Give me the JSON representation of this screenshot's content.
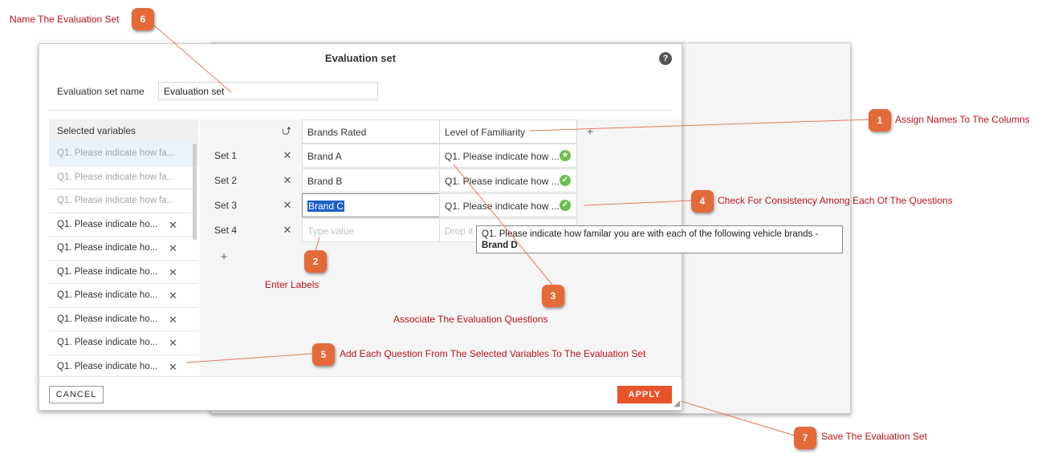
{
  "dialog": {
    "title": "Evaluation set",
    "help_glyph": "?",
    "name_label": "Evaluation set name",
    "name_value": "Evaluation set",
    "cancel_label": "CANCEL",
    "apply_label": "APPLY"
  },
  "variables": {
    "header": "Selected variables",
    "items": [
      {
        "label": "Q1. Please indicate how fa...",
        "used": true
      },
      {
        "label": "Q1. Please indicate how fa...",
        "used": true
      },
      {
        "label": "Q1. Please indicate how fa...",
        "used": true
      },
      {
        "label": "Q1. Please indicate ho...",
        "used": false
      },
      {
        "label": "Q1. Please indicate ho...",
        "used": false
      },
      {
        "label": "Q1. Please indicate ho...",
        "used": false
      },
      {
        "label": "Q1. Please indicate ho...",
        "used": false
      },
      {
        "label": "Q1. Please indicate ho...",
        "used": false
      },
      {
        "label": "Q1. Please indicate ho...",
        "used": false
      },
      {
        "label": "Q1. Please indicate ho...",
        "used": false
      }
    ],
    "remove_glyph": "✕"
  },
  "grid": {
    "columns": [
      "Brands Rated",
      "Level of Familiarity"
    ],
    "rows": [
      {
        "label": "Set 1",
        "brand": "Brand A",
        "question": "Q1. Please indicate how ..."
      },
      {
        "label": "Set 2",
        "brand": "Brand B",
        "question": "Q1. Please indicate how ..."
      },
      {
        "label": "Set 3",
        "brand": "Brand C",
        "question": "Q1. Please indicate how ..."
      },
      {
        "label": "Set 4",
        "brand_placeholder": "Type value",
        "question_placeholder": "Drop it"
      }
    ],
    "remove_glyph": "✕",
    "add_glyph": "+",
    "swap_glyph": "⮍"
  },
  "tooltip": {
    "line1": "Q1. Please indicate how familar you are with each of the following vehicle brands -",
    "line2": "Brand D"
  },
  "annotations": [
    {
      "num": "1",
      "text": "Assign Names To The Columns"
    },
    {
      "num": "2",
      "text": "Enter Labels"
    },
    {
      "num": "3",
      "text": "Associate The Evaluation Questions"
    },
    {
      "num": "4",
      "text": "Check For Consistency Among Each Of The Questions"
    },
    {
      "num": "5",
      "text": "Add Each Question From The Selected Variables To The Evaluation Set"
    },
    {
      "num": "6",
      "text": "Name The Evaluation Set"
    },
    {
      "num": "7",
      "text": "Save The Evaluation Set"
    }
  ],
  "colors": {
    "accent": "#e8532a",
    "badge": "#e46a3a",
    "note_text": "#b8141d",
    "ok": "#6cbf4e",
    "selection": "#1e5fc7"
  }
}
